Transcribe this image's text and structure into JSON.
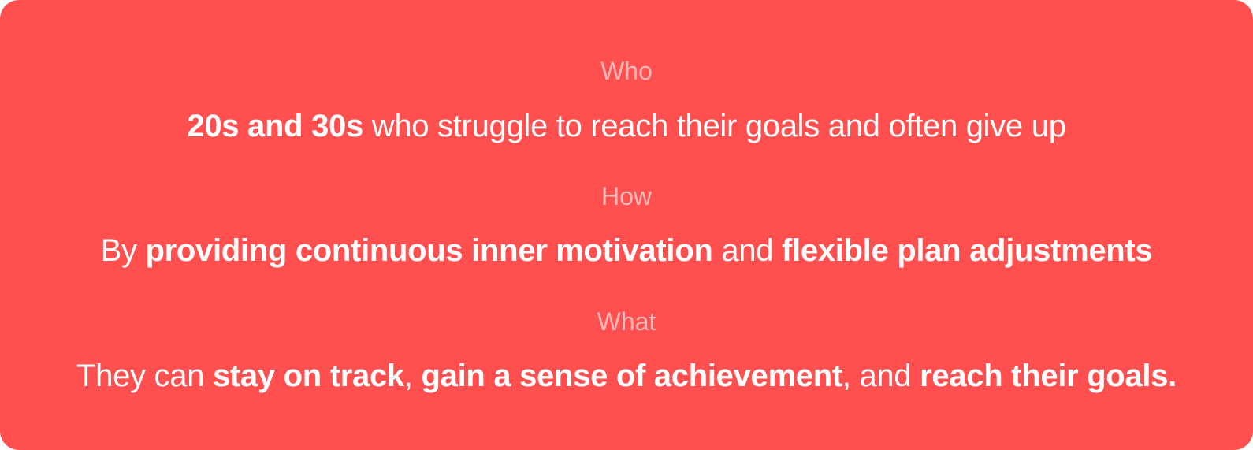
{
  "colors": {
    "card_background": "#ff4f4f",
    "label_text": "rgba(255,255,255,0.6)",
    "statement_text": "#ffffff"
  },
  "sections": {
    "who": {
      "label": "Who",
      "parts": [
        {
          "text": "20s and 30s",
          "bold": true
        },
        {
          "text": " who struggle to reach their goals and often give up",
          "bold": false
        }
      ]
    },
    "how": {
      "label": "How",
      "parts": [
        {
          "text": "By ",
          "bold": false
        },
        {
          "text": "providing continuous inner motivation",
          "bold": true
        },
        {
          "text": " and ",
          "bold": false
        },
        {
          "text": "flexible plan adjustments",
          "bold": true
        }
      ]
    },
    "what": {
      "label": "What",
      "parts": [
        {
          "text": "They can ",
          "bold": false
        },
        {
          "text": "stay on track",
          "bold": true
        },
        {
          "text": ", ",
          "bold": false
        },
        {
          "text": "gain a sense of achievement",
          "bold": true
        },
        {
          "text": ", and ",
          "bold": false
        },
        {
          "text": "reach their goals.",
          "bold": true
        }
      ]
    }
  }
}
